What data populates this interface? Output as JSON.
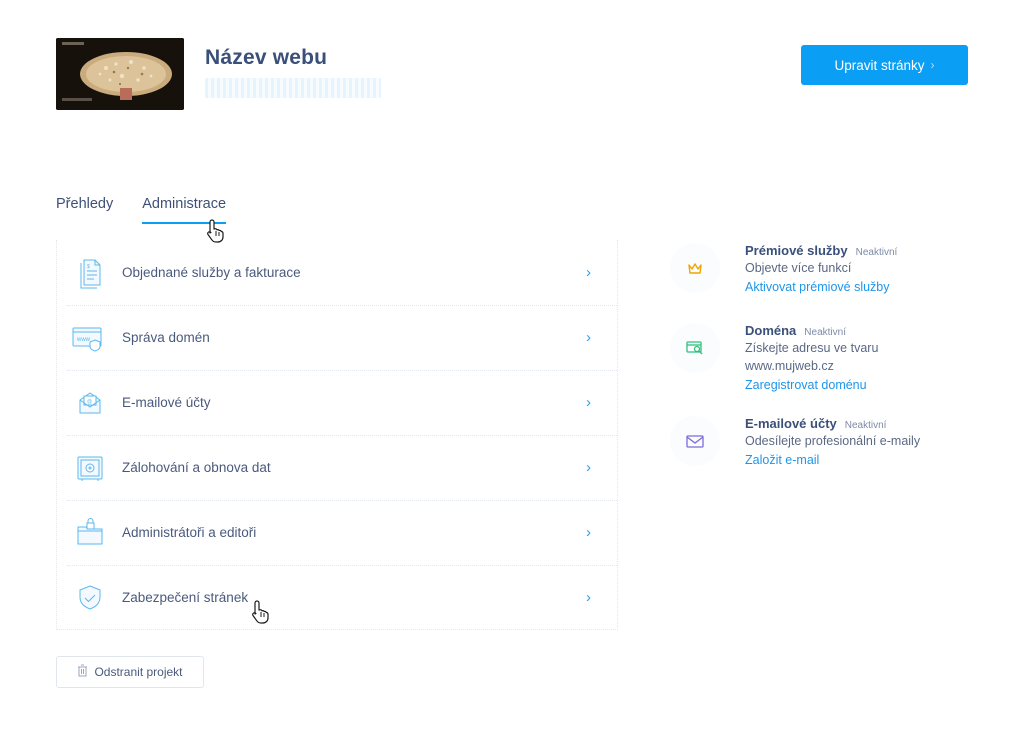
{
  "header": {
    "site_title": "Název webu",
    "edit_button": "Upravit stránky"
  },
  "tabs": [
    {
      "label": "Přehledy",
      "active": false
    },
    {
      "label": "Administrace",
      "active": true
    }
  ],
  "admin_items": [
    {
      "label": "Objednané služby a fakturace",
      "icon": "invoice-icon"
    },
    {
      "label": "Správa domén",
      "icon": "domain-icon"
    },
    {
      "label": "E-mailové účty",
      "icon": "envelope-icon"
    },
    {
      "label": "Zálohování a obnova dat",
      "icon": "safe-icon"
    },
    {
      "label": "Administrátoři a editoři",
      "icon": "folder-lock-icon"
    },
    {
      "label": "Zabezpečení stránek",
      "icon": "shield-check-icon"
    }
  ],
  "services": [
    {
      "name": "Prémiové služby",
      "badge": "Neaktivní",
      "desc": [
        "Objevte více funkcí"
      ],
      "link": "Aktivovat prémiové služby",
      "icon": "crown-icon",
      "color": "#f0a500"
    },
    {
      "name": "Doména",
      "badge": "Neaktivní",
      "desc": [
        "Získejte adresu ve tvaru",
        "www.mujweb.cz"
      ],
      "link": "Zaregistrovat doménu",
      "icon": "domain-search-icon",
      "color": "#2ec27e"
    },
    {
      "name": "E-mailové účty",
      "badge": "Neaktivní",
      "desc": [
        "Odesílejte profesionální e-maily"
      ],
      "link": "Založit e-mail",
      "icon": "mail-icon",
      "color": "#7d6ad9"
    }
  ],
  "delete_button": "Odstranit projekt",
  "colors": {
    "accent": "#0b9ef5",
    "title": "#3a4f7a"
  }
}
